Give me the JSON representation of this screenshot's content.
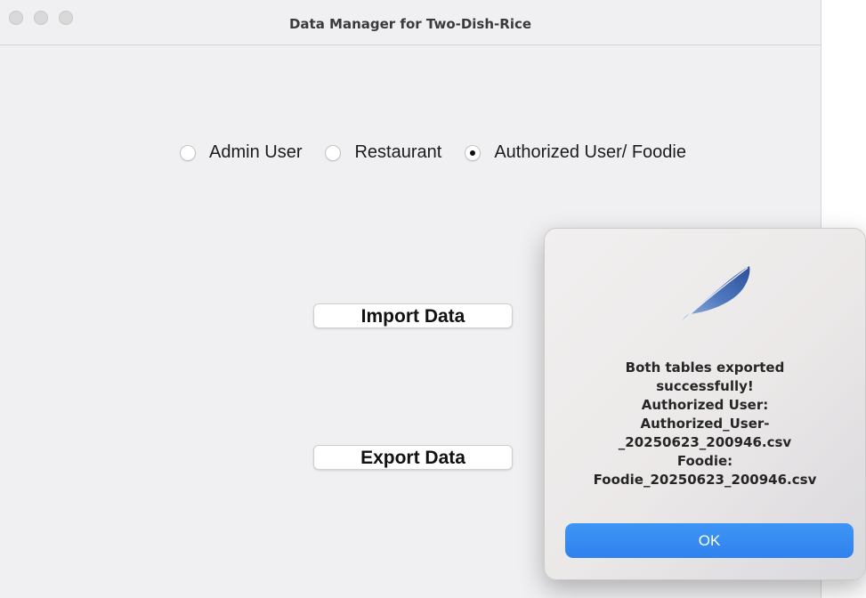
{
  "window": {
    "title": "Data Manager for Two-Dish-Rice"
  },
  "radio_options": [
    {
      "label": "Admin User",
      "checked": false
    },
    {
      "label": "Restaurant",
      "checked": false
    },
    {
      "label": "Authorized User/ Foodie",
      "checked": true
    }
  ],
  "buttons": {
    "import_label": "Import Data",
    "export_label": "Export Data"
  },
  "dialog": {
    "icon": "feather-icon",
    "message_lines": [
      "Both tables exported",
      "successfully!",
      "Authorized User:",
      "Authorized_User-",
      "_20250623_200946.csv",
      "Foodie:",
      "Foodie_20250623_200946.csv"
    ],
    "ok_label": "OK"
  },
  "colors": {
    "window_bg": "#f0f0f2",
    "ok_button": "#3587f0"
  }
}
